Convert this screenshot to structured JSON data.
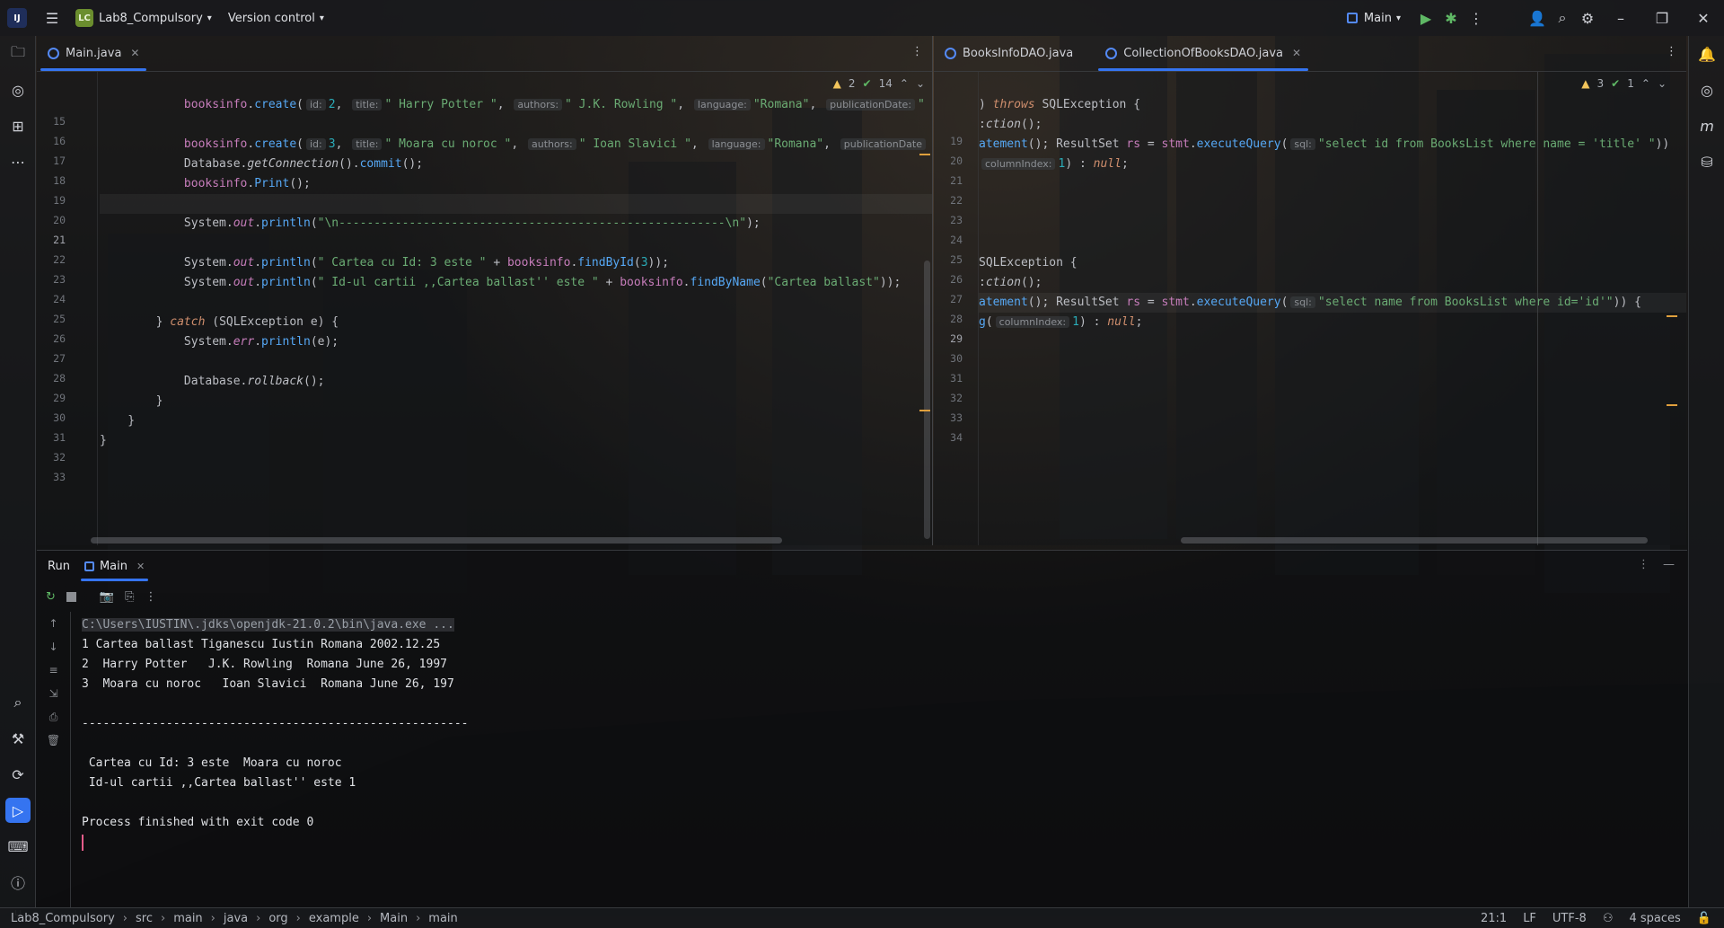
{
  "titlebar": {
    "project_badge": "LC",
    "project_name": "Lab8_Compulsory",
    "vcs_label": "Version control",
    "run_config": "Main"
  },
  "editor_left": {
    "tab_label": "Main.java",
    "inspections": {
      "warnings": "2",
      "ok": "14"
    },
    "line_numbers": [
      "15",
      "16",
      "17",
      "18",
      "19",
      "20",
      "21",
      "22",
      "23",
      "24",
      "25",
      "26",
      "27",
      "28",
      "29",
      "30",
      "31",
      "32",
      "33"
    ]
  },
  "editor_right": {
    "tabs": [
      "BooksInfoDAO.java",
      "CollectionOfBooksDAO.java"
    ],
    "inspections": {
      "warnings": "3",
      "ok": "1"
    },
    "line_numbers": [
      "19",
      "20",
      "21",
      "22",
      "23",
      "24",
      "25",
      "26",
      "27",
      "28",
      "29",
      "30",
      "31",
      "32",
      "33",
      "34"
    ]
  },
  "run_panel": {
    "run_label": "Run",
    "main_tab": "Main",
    "console": {
      "command": "C:\\Users\\IUSTIN\\.jdks\\openjdk-21.0.2\\bin\\java.exe ...",
      "lines": [
        "1 Cartea ballast Tiganescu Iustin Romana 2002.12.25",
        "2  Harry Potter   J.K. Rowling  Romana June 26, 1997",
        "3  Moara cu noroc   Ioan Slavici  Romana June 26, 197",
        "",
        "-------------------------------------------------------",
        "",
        " Cartea cu Id: 3 este  Moara cu noroc",
        " Id-ul cartii ,,Cartea ballast'' este 1",
        "",
        "Process finished with exit code 0"
      ]
    }
  },
  "statusbar": {
    "breadcrumb": [
      "Lab8_Compulsory",
      "src",
      "main",
      "java",
      "org",
      "example",
      "Main",
      "main"
    ],
    "position": "21:1",
    "line_sep": "LF",
    "encoding": "UTF-8",
    "indent": "4 spaces"
  },
  "colors": {
    "accent": "#3574f0",
    "keyword": "#cf8e6d",
    "string": "#6aab73",
    "field": "#c77dbb",
    "method": "#56a8f5"
  }
}
